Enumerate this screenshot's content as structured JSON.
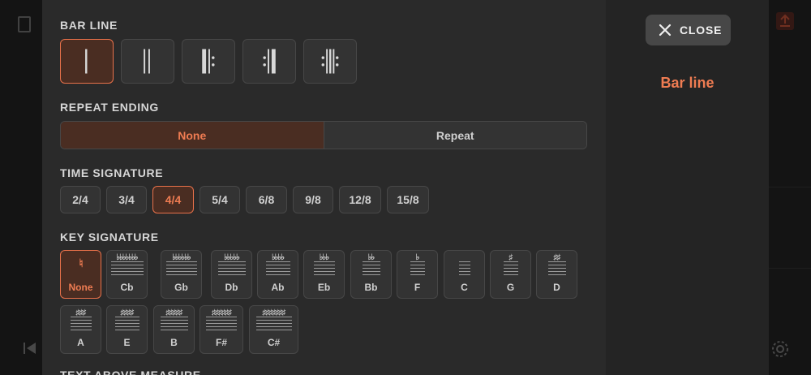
{
  "header": {
    "close_label": "CLOSE",
    "side_title": "Bar line"
  },
  "sections": {
    "bar_line": "BAR LINE",
    "repeat_ending": "REPEAT ENDING",
    "time_signature": "TIME SIGNATURE",
    "key_signature": "KEY SIGNATURE",
    "text_above_measure": "TEXT ABOVE MEASURE"
  },
  "bar_line_options": [
    {
      "name": "single",
      "selected": true
    },
    {
      "name": "double",
      "selected": false
    },
    {
      "name": "start-repeat",
      "selected": false
    },
    {
      "name": "end-repeat",
      "selected": false
    },
    {
      "name": "end-start-repeat",
      "selected": false
    }
  ],
  "repeat_ending": {
    "options": [
      "None",
      "Repeat"
    ],
    "selected": "None"
  },
  "time_signatures": {
    "options": [
      "2/4",
      "3/4",
      "4/4",
      "5/4",
      "6/8",
      "9/8",
      "12/8",
      "15/8"
    ],
    "selected": "4/4"
  },
  "key_signatures": {
    "selected": "None",
    "row1": [
      {
        "label": "None",
        "acc": "♮"
      },
      {
        "label": "Cb",
        "acc": "♭♭♭♭♭♭♭"
      },
      {
        "label": "Gb",
        "acc": "♭♭♭♭♭♭"
      },
      {
        "label": "Db",
        "acc": "♭♭♭♭♭"
      },
      {
        "label": "Ab",
        "acc": "♭♭♭♭"
      },
      {
        "label": "Eb",
        "acc": "♭♭♭"
      },
      {
        "label": "Bb",
        "acc": "♭♭"
      },
      {
        "label": "F",
        "acc": "♭"
      },
      {
        "label": "C",
        "acc": ""
      },
      {
        "label": "G",
        "acc": "♯"
      },
      {
        "label": "D",
        "acc": "♯♯"
      }
    ],
    "row2": [
      {
        "label": "A",
        "acc": "♯♯♯"
      },
      {
        "label": "E",
        "acc": "♯♯♯♯"
      },
      {
        "label": "B",
        "acc": "♯♯♯♯♯"
      },
      {
        "label": "F#",
        "acc": "♯♯♯♯♯♯"
      },
      {
        "label": "C#",
        "acc": "♯♯♯♯♯♯♯"
      }
    ]
  },
  "colors": {
    "accent": "#ef7c52",
    "selected_bg": "#4a2d22",
    "panel": "#2a2a2a",
    "button": "#333333"
  }
}
